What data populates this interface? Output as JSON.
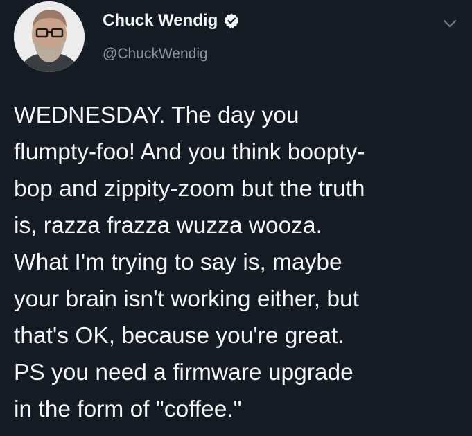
{
  "author": {
    "display_name": "Chuck Wendig",
    "handle": "@ChuckWendig",
    "verified": true,
    "avatar_icon": "user-avatar-photo"
  },
  "tweet": {
    "text_lines": [
      "WEDNESDAY. The day you",
      "flumpty-foo! And you think boopty-",
      "bop and zippity-zoom but the truth",
      "is, razza frazza wuzza wooza.",
      "What I'm trying to say is, maybe",
      "your brain isn't working either, but",
      "that's OK, because you're great.",
      "PS you need a firmware upgrade",
      "in the form of \"coffee.\""
    ]
  },
  "icons": {
    "verified": "verified-badge-icon",
    "menu": "chevron-down-icon"
  },
  "colors": {
    "background": "#151b24",
    "text": "#f5f7f8",
    "secondary_text": "#8d98a3",
    "chevron": "#6b7682"
  }
}
